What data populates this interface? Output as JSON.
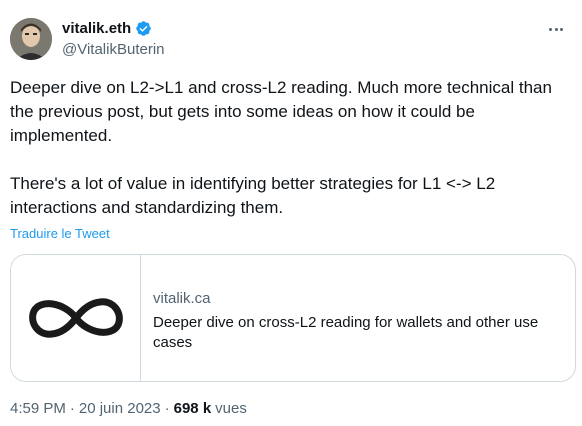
{
  "author": {
    "display_name": "vitalik.eth",
    "handle": "@VitalikButerin"
  },
  "tweet": {
    "paragraph_1": "Deeper dive on L2->L1 and cross-L2 reading. Much more technical than the previous post, but gets into some ideas on how it could be implemented.",
    "paragraph_2": "There's a lot of value in identifying better strategies for L1 <-> L2 interactions and standardizing them.",
    "translate_link": "Traduire le Tweet"
  },
  "card": {
    "domain": "vitalik.ca",
    "title": "Deeper dive on cross-L2 reading for wallets and other use cases",
    "thumbnail_icon": "infinity-icon"
  },
  "meta": {
    "time": "4:59 PM",
    "date": "20 juin 2023",
    "separator": "·",
    "views_count": "698 k",
    "views_label": "vues"
  },
  "colors": {
    "accent": "#1d9bf0",
    "secondary_text": "#536471",
    "border": "#cfd9de"
  }
}
